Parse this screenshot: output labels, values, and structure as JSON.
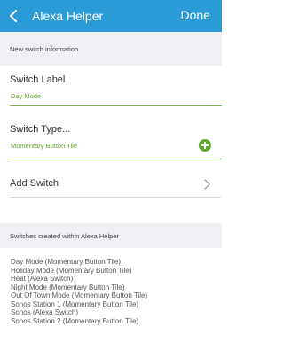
{
  "nav": {
    "back_icon": "chevron-left-icon",
    "title": "Alexa Helper",
    "done_label": "Done"
  },
  "new_switch": {
    "section_title": "New switch information",
    "label_field": {
      "label": "Switch Label",
      "value": "Day Mode"
    },
    "type_field": {
      "label": "Switch Type...",
      "value": "Momentary Button Tile",
      "add_icon": "plus-circle-icon"
    },
    "add_switch": {
      "label": "Add Switch",
      "icon": "chevron-right-icon"
    }
  },
  "existing": {
    "section_title": "Switches created within Alexa Helper",
    "switches": [
      "Day Mode (Momentary Button Tile)",
      "Holiday Mode (Momentary Button Tile)",
      "Heat (Alexa Switch)",
      "Night Mode (Momentary Button Tile)",
      "Out Of Town Mode (Momentary Button Tile)",
      "Sonos Station 1 (Momentary Button Tile)",
      "Sonos (Alexa Switch)",
      "Sonos Station 2 (Momentary Button Tile)"
    ]
  },
  "colors": {
    "nav_bar": "#2a9bd6",
    "accent_green": "#6aa12e",
    "section_bg": "#efeff4"
  }
}
